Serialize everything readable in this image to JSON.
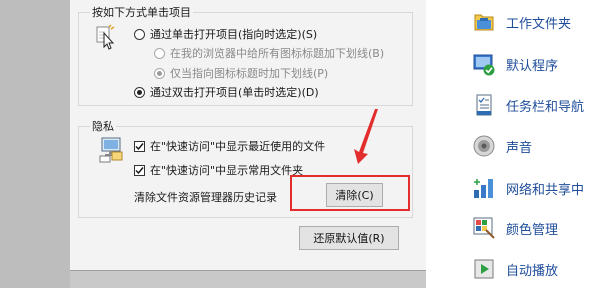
{
  "click_items": {
    "title": "按如下方式单击项目",
    "options": [
      {
        "label": "通过单击打开项目(指向时选定)(S)"
      },
      {
        "label": "在我的浏览器中给所有图标标题加下划线(B)"
      },
      {
        "label": "仅当指向图标标题时加下划线(P)"
      },
      {
        "label": "通过双击打开项目(单击时选定)(D)"
      }
    ]
  },
  "privacy": {
    "title": "隐私",
    "checkboxes": [
      {
        "label": "在\"快速访问\"中显示最近使用的文件",
        "checked": true
      },
      {
        "label": "在\"快速访问\"中显示常用文件夹",
        "checked": true
      }
    ],
    "clear_history_label": "清除文件资源管理器历史记录",
    "clear_button": "清除(C)"
  },
  "restore_defaults_button": "还原默认值(R)",
  "control_panel": {
    "items": [
      {
        "label": "工作文件夹",
        "icon": "work-folders-icon"
      },
      {
        "label": "默认程序",
        "icon": "default-programs-icon"
      },
      {
        "label": "任务栏和导航",
        "icon": "taskbar-icon"
      },
      {
        "label": "声音",
        "icon": "sound-icon"
      },
      {
        "label": "网络和共享中",
        "icon": "network-icon"
      },
      {
        "label": "颜色管理",
        "icon": "color-management-icon"
      },
      {
        "label": "自动播放",
        "icon": "autoplay-icon"
      }
    ]
  },
  "colors": {
    "annotation": "#e32c2c",
    "link": "#1e4d9a"
  }
}
